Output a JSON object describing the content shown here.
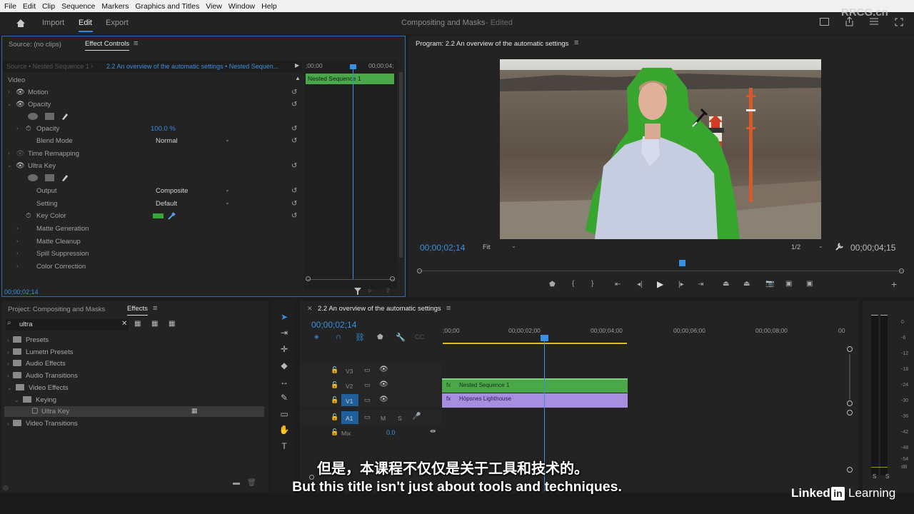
{
  "menu": [
    "File",
    "Edit",
    "Clip",
    "Sequence",
    "Markers",
    "Graphics and Titles",
    "View",
    "Window",
    "Help"
  ],
  "workspaces": {
    "import": "Import",
    "edit": "Edit",
    "export": "Export"
  },
  "project_title": "Compositing and Masks",
  "project_status": "- Edited",
  "watermark": "RRCG.cn",
  "source_panel": {
    "source_tab": "Source: (no clips)",
    "effect_controls_tab": "Effect Controls",
    "source_clip": "Source • Nested Sequence 1",
    "seq_name": "2.2 An overview of the automatic settings • Nested Sequen...",
    "time_start": ";00;00",
    "time_end": "00;00;04;",
    "clip_label": "Nested Sequence 1",
    "timecode": "00;00;02;14"
  },
  "effect_controls": {
    "section": "Video",
    "motion": "Motion",
    "opacity": "Opacity",
    "opacity_param": "Opacity",
    "opacity_value": "100.0 %",
    "blend_mode": "Blend Mode",
    "blend_value": "Normal",
    "time_remap": "Time Remapping",
    "ultra_key": "Ultra Key",
    "output": "Output",
    "output_value": "Composite",
    "setting": "Setting",
    "setting_value": "Default",
    "key_color": "Key Color",
    "key_color_hex": "#3aa53a",
    "matte_generation": "Matte Generation",
    "matte_cleanup": "Matte Cleanup",
    "spill_suppression": "Spill Suppression",
    "color_correction": "Color Correction"
  },
  "program": {
    "title": "Program: 2.2 An overview of the automatic settings",
    "timecode": "00;00;02;14",
    "fit": "Fit",
    "resolution": "1/2",
    "duration": "00;00;04;15"
  },
  "project_panel": {
    "project_tab": "Project: Compositing and Masks",
    "effects_tab": "Effects",
    "search_value": "ultra",
    "items": [
      "Presets",
      "Lumetri Presets",
      "Audio Effects",
      "Audio Transitions",
      "Video Effects",
      "Keying",
      "Ultra Key",
      "Video Transitions"
    ]
  },
  "timeline": {
    "tab": "2.2 An overview of the automatic settings",
    "timecode": "00;00;02;14",
    "ruler": [
      ";00;00",
      "00;00;02;00",
      "00;00;04;00",
      "00;00;06;00",
      "00;00;08;00",
      "00"
    ],
    "tracks": {
      "v3": "V3",
      "v2": "V2",
      "v1": "V1",
      "a1": "A1",
      "m": "M",
      "s": "S",
      "mix": "Mix",
      "mix_value": "0.0"
    },
    "clip_v2": "Nested Sequence 1",
    "clip_v1": "Höpsnes Lighthouse"
  },
  "meter": {
    "scale": [
      "0",
      "-6",
      "-12",
      "-18",
      "-24",
      "-30",
      "-36",
      "-42",
      "-48",
      "-54",
      "dB"
    ],
    "solo": [
      "S",
      "S"
    ]
  },
  "subtitles": {
    "cn": "但是，本课程不仅仅是关于工具和技术的。",
    "en": "But this title isn't just about tools and techniques."
  },
  "brand": {
    "linkedin": "Linked",
    "in": "in",
    "learning": "Learning"
  },
  "colors": {
    "accent": "#2d8ceb",
    "clip_green": "#4aa84a",
    "clip_purple": "#a88ee0",
    "playhead": "#3a8fe0"
  }
}
